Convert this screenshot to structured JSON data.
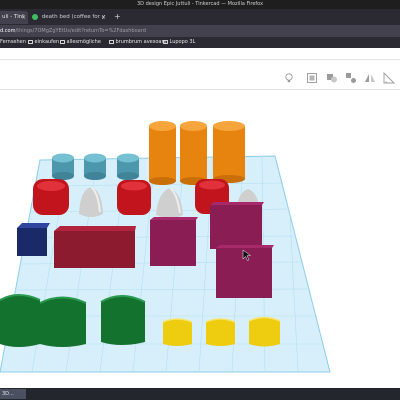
{
  "window": {
    "title": "3D design Epic Juttuli - Tinkercad — Mozilla Firefox"
  },
  "tabs": [
    {
      "label": "uli - Tinl",
      "close": "×"
    },
    {
      "label": "death bed (coffee for y",
      "close": "×"
    }
  ],
  "new_tab": "+",
  "address_bar": {
    "host": "d.com",
    "path": "/things/7OMgZgYEtUs/edit?returnTo=%2Fdashboard"
  },
  "bookmarks": [
    {
      "label": "Fernsehen"
    },
    {
      "label": "einkaufen"
    },
    {
      "label": "allesmögliche"
    },
    {
      "label": "brumbrum avesoars"
    },
    {
      "label": "Lupopo 3L"
    }
  ],
  "toolbar_icons": [
    "light-bulb-icon",
    "align-icon",
    "group-icon",
    "ungroup-icon",
    "mirror-icon",
    "workplane-icon",
    "ruler-icon"
  ],
  "taskbar": {
    "task_label": "3D..."
  },
  "colors": {
    "grid": "#d6effa",
    "grid_line": "#a9dcf0",
    "cyan": "#56a9bd",
    "red": "#c4151d",
    "grey": "#d0d0d0",
    "orange": "#ef8a12",
    "navy": "#1b2d6f",
    "maroon": "#8f1a30",
    "purple": "#8e1d57",
    "green": "#157a38",
    "yellow": "#f1d212"
  }
}
